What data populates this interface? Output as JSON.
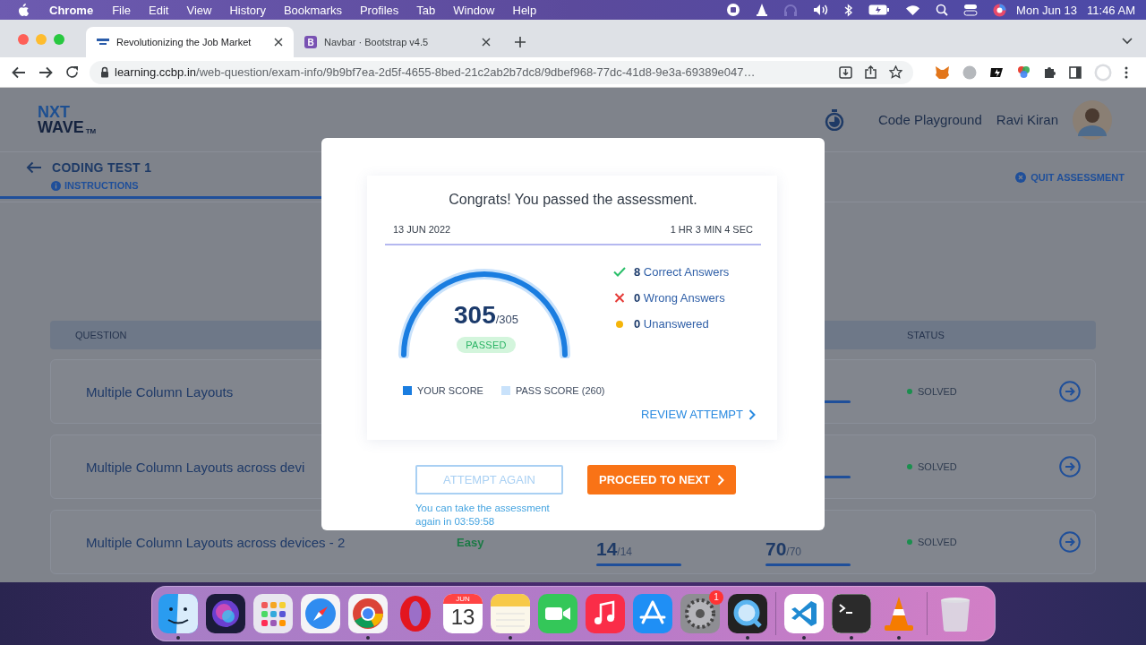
{
  "menu_bar": {
    "app": "Chrome",
    "items": [
      "File",
      "Edit",
      "View",
      "History",
      "Bookmarks",
      "Profiles",
      "Tab",
      "Window",
      "Help"
    ],
    "date": "Mon Jun 13",
    "time": "11:46 AM"
  },
  "browser": {
    "tabs": [
      {
        "title": "Revolutionizing the Job Market",
        "selected": true,
        "kind": "site"
      },
      {
        "title": "Navbar · Bootstrap v4.5",
        "selected": false,
        "kind": "letter",
        "favicon_letter": "B"
      }
    ],
    "url_host": "learning.ccbp.in",
    "url_path": "/web-question/exam-info/9b9bf7ea-2d5f-4655-8bed-21c2ab2b7dc8/9dbef968-77dc-41d8-9e3a-69389e047…"
  },
  "page": {
    "logo_top": "NXT",
    "logo_bottom": "WAVE",
    "logo_mark": "TM",
    "code_playground": "Code Playground",
    "user_name": "Ravi Kiran",
    "title": "CODING TEST 1",
    "tabs": [
      {
        "label": "INSTRUCTIONS",
        "selected": true
      }
    ],
    "quit": "QUIT ASSESSMENT",
    "table": {
      "columns": [
        "QUESTION",
        "STATUS"
      ],
      "rows": [
        {
          "question": "Multiple Column Layouts",
          "status": "SOLVED",
          "color": "#1a8f4e"
        },
        {
          "question": "Multiple Column Layouts across devi",
          "status": "SOLVED",
          "color": "#1a8f4e"
        },
        {
          "question": "Multiple Column Layouts across devices - 2",
          "difficulty": "Easy",
          "score_1": "14",
          "score_1_total": "/14",
          "score_2": "70",
          "score_2_total": "/70",
          "status": "SOLVED",
          "color": "#1a8f4e"
        }
      ]
    }
  },
  "modal": {
    "title": "Congrats! You passed the assessment.",
    "date": "13 JUN 2022",
    "duration": "1 HR 3 MIN 4 SEC",
    "score": "305",
    "score_total": "/305",
    "level": 1,
    "result": "PASSED",
    "stats": [
      {
        "kind": "correct",
        "text": "**8** Correct Answers"
      },
      {
        "kind": "wrong",
        "text": "**0** Wrong Answers"
      },
      {
        "kind": "unanswered",
        "text": "**0** Unanswered"
      }
    ],
    "legend": [
      "YOUR SCORE",
      "PASS SCORE (260)"
    ],
    "review": "REVIEW ATTEMPT",
    "attempt_again": "ATTEMPT AGAIN",
    "attempt_disabled": true,
    "proceed": "PROCEED TO NEXT",
    "note": "You can take the assessment again in 03:59:58"
  },
  "dock": [
    {
      "kind": "finder",
      "running": true
    },
    {
      "kind": "orb",
      "running": false
    },
    {
      "kind": "grid",
      "running": false
    },
    {
      "kind": "compass",
      "running": false
    },
    {
      "kind": "wheel",
      "running": true
    },
    {
      "kind": "ring",
      "running": false
    },
    {
      "kind": "calendar",
      "month": "JUN",
      "day": "13",
      "running": false
    },
    {
      "kind": "notes",
      "running": true
    },
    {
      "kind": "camera",
      "running": false
    },
    {
      "kind": "music",
      "running": false
    },
    {
      "kind": "tools",
      "running": false
    },
    {
      "kind": "gear",
      "badge": "1",
      "running": false
    },
    {
      "kind": "magnifier",
      "running": true
    },
    {
      "kind": "separator"
    },
    {
      "kind": "code",
      "running": true
    },
    {
      "kind": "terminal",
      "running": true
    },
    {
      "kind": "cone",
      "running": true
    },
    {
      "kind": "separator"
    },
    {
      "kind": "trash",
      "running": false
    }
  ]
}
